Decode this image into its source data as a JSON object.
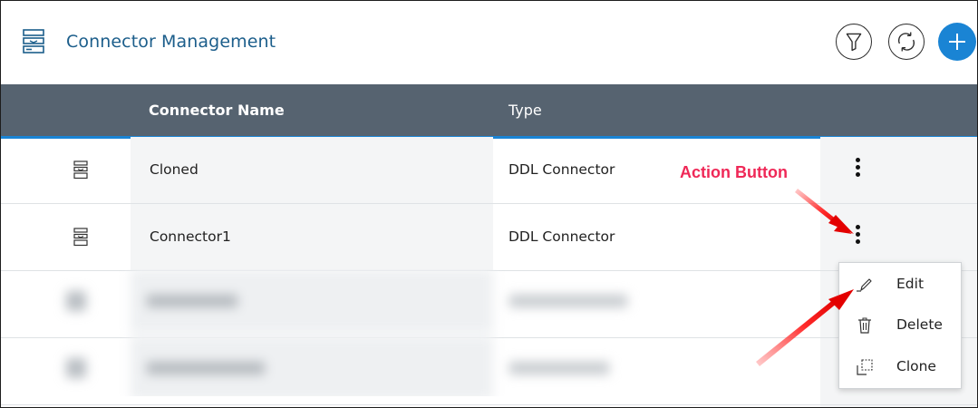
{
  "header": {
    "title": "Connector Management",
    "app_icon": "connector-stack-icon",
    "filter_icon": "filter-icon",
    "refresh_icon": "refresh-icon",
    "add_icon": "plus-icon"
  },
  "table": {
    "columns": [
      "Connector Name",
      "Type"
    ],
    "rows": [
      {
        "icon": "connector-stack-icon",
        "name": "Cloned",
        "type": "DDL Connector",
        "action_icon": "kebab-menu-icon"
      },
      {
        "icon": "connector-stack-icon",
        "name": "Connector1",
        "type": "DDL Connector",
        "action_icon": "kebab-menu-icon"
      }
    ]
  },
  "context_menu": {
    "items": [
      {
        "label": "Edit",
        "icon": "pencil-icon"
      },
      {
        "label": "Delete",
        "icon": "trash-icon"
      },
      {
        "label": "Clone",
        "icon": "clone-icon"
      }
    ]
  },
  "annotation": {
    "label": "Action Button",
    "color": "#ef2857"
  },
  "colors": {
    "accent": "#1a84d4",
    "header_bg": "#566370",
    "title": "#1c5e8b",
    "annotation": "#ef2857"
  }
}
